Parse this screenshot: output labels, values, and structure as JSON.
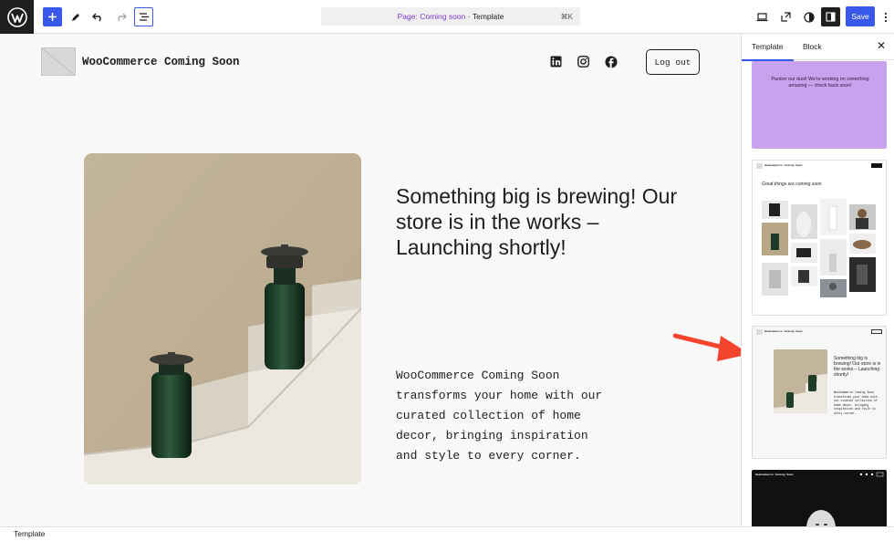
{
  "toolbar": {
    "page_label": "Page: Coming soon",
    "separator": " · ",
    "template_label": "Template",
    "shortcut": "⌘K",
    "save_label": "Save"
  },
  "site": {
    "title": "WooCommerce Coming Soon",
    "logout_label": "Log out",
    "headline": "Something big is brewing! Our store is in the works – Launching shortly!",
    "description": "WooCommerce Coming Soon transforms your home with our curated collection of home decor, bringing inspiration and style to every corner."
  },
  "sidebar": {
    "tab_template": "Template",
    "tab_block": "Block",
    "card1_text": "Pardon our dust! We're working on something amazing — check back soon!",
    "card2_title": "WooCommerce Coming Soon",
    "card2_headline": "Great things are coming soon",
    "card3_title": "WooCommerce Coming Soon",
    "card3_headline": "Something big is brewing! Our store is in the works – Launching shortly!",
    "card3_desc": "WooCommerce Coming Soon transforms your home with our curated collection of home decor, bringing inspiration and style to every corner.",
    "card4_title": "WooCommerce Coming Soon"
  },
  "status_bar": {
    "label": "Template"
  },
  "colors": {
    "accent": "#3858e9",
    "purple_card": "#c9a2ee",
    "arrow": "#f4442e"
  }
}
